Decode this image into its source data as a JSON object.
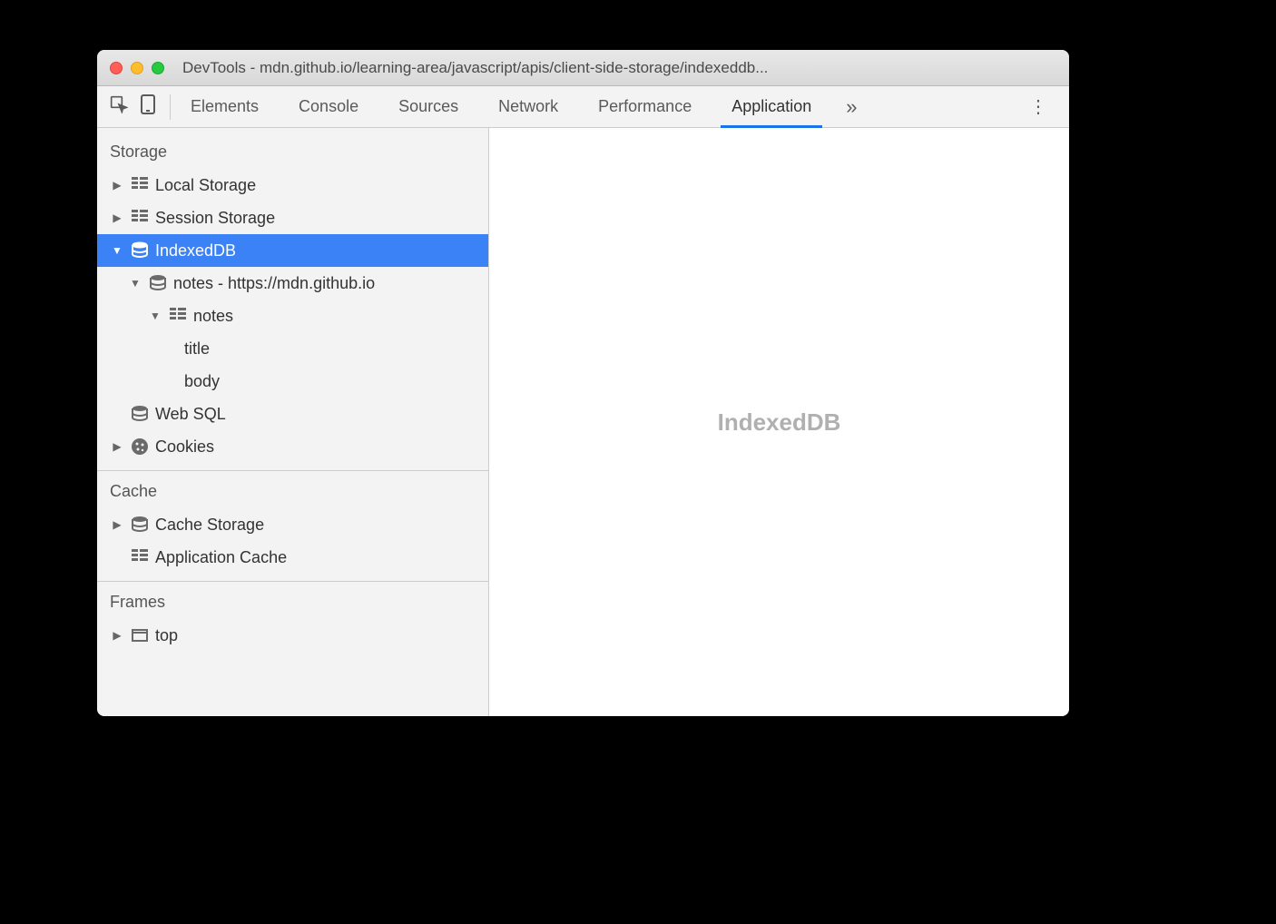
{
  "window": {
    "title": "DevTools - mdn.github.io/learning-area/javascript/apis/client-side-storage/indexeddb..."
  },
  "tabs": {
    "items": [
      "Elements",
      "Console",
      "Sources",
      "Network",
      "Performance",
      "Application"
    ],
    "active_index": 5
  },
  "sidebar": {
    "sections": {
      "storage": {
        "title": "Storage",
        "local_storage": "Local Storage",
        "session_storage": "Session Storage",
        "indexeddb": "IndexedDB",
        "indexeddb_db": "notes - https://mdn.github.io",
        "indexeddb_store": "notes",
        "indexeddb_indexes": [
          "title",
          "body"
        ],
        "web_sql": "Web SQL",
        "cookies": "Cookies"
      },
      "cache": {
        "title": "Cache",
        "cache_storage": "Cache Storage",
        "application_cache": "Application Cache"
      },
      "frames": {
        "title": "Frames",
        "top": "top"
      }
    }
  },
  "main": {
    "placeholder": "IndexedDB"
  }
}
